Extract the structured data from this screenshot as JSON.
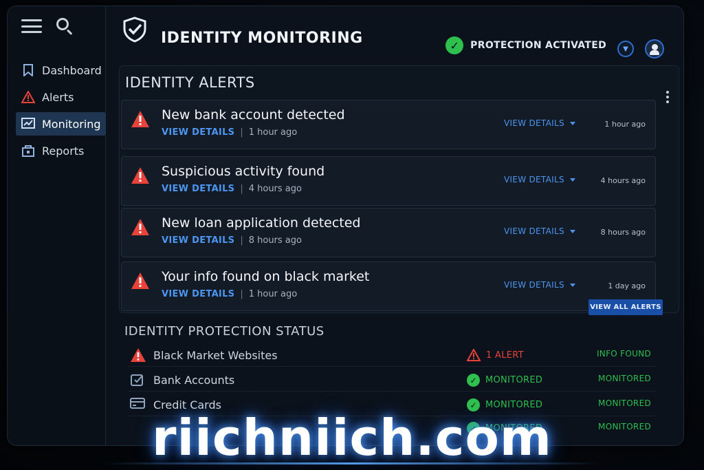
{
  "header": {
    "title": "IDENTITY MONITORING",
    "protection_status": "PROTECTION ACTIVATED"
  },
  "sidebar": {
    "items": [
      {
        "label": "Dashboard",
        "icon": "bookmark-icon",
        "active": false
      },
      {
        "label": "Alerts",
        "icon": "warning-icon",
        "active": false
      },
      {
        "label": "Monitoring",
        "icon": "monitor-icon",
        "active": true
      },
      {
        "label": "Reports",
        "icon": "report-icon",
        "active": false
      }
    ]
  },
  "alerts_panel": {
    "title": "IDENTITY ALERTS",
    "view_all_label": "VIEW ALL ALERTS",
    "alerts": [
      {
        "title": "New bank account detected",
        "link": "VIEW DETAILS",
        "sub_time": "1 hour ago",
        "right_link": "VIEW DETAILS",
        "right_time": "1 hour ago"
      },
      {
        "title": "Suspicious activity found",
        "link": "VIEW DETAILS",
        "sub_time": "4 hours ago",
        "right_link": "VIEW DETAILS",
        "right_time": "4 hours ago"
      },
      {
        "title": "New loan application detected",
        "link": "VIEW DETAILS",
        "sub_time": "8 hours ago",
        "right_link": "VIEW DETAILS",
        "right_time": "8 hours ago"
      },
      {
        "title": "Your info found on black market",
        "link": "VIEW DETAILS",
        "sub_time": "1 hour ago",
        "right_link": "VIEW DETAILS",
        "right_time": "1 day ago"
      }
    ]
  },
  "status_panel": {
    "title": "IDENTITY PROTECTION STATUS",
    "rows": [
      {
        "name": "Black Market Websites",
        "state": "1 ALERT",
        "right": "INFO FOUND"
      },
      {
        "name": "Bank Accounts",
        "state": "MONITORED",
        "right": "MONITORED"
      },
      {
        "name": "Credit Cards",
        "state": "MONITORED",
        "right": "MONITORED"
      },
      {
        "name": "",
        "state": "MONITORED",
        "right": "MONITORED"
      }
    ]
  },
  "watermark": "riichniich.com",
  "colors": {
    "accent_blue": "#4c95f0",
    "alert_red": "#e8433b",
    "ok_green": "#2fbf4f",
    "active_nav": "#1f3652"
  }
}
